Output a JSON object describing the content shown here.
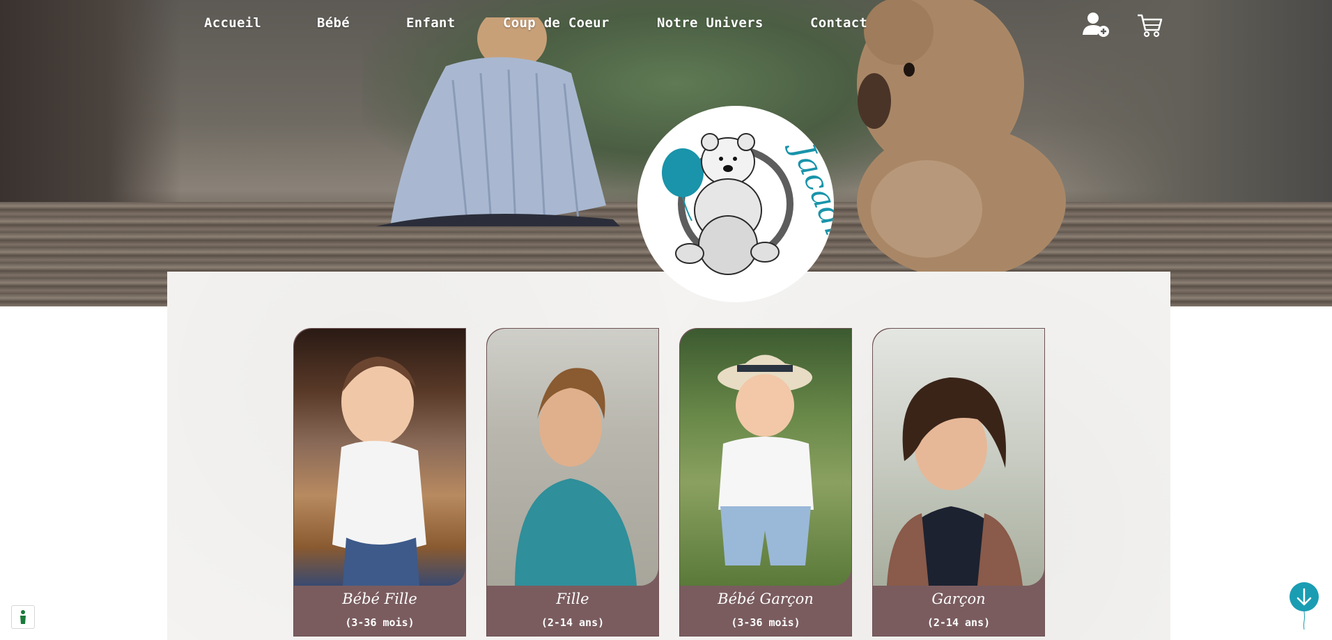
{
  "nav": {
    "items": [
      {
        "label": "Accueil"
      },
      {
        "label": "Bébé"
      },
      {
        "label": "Enfant"
      },
      {
        "label": "Coup de Coeur"
      },
      {
        "label": "Notre Univers"
      },
      {
        "label": "Contact"
      }
    ],
    "account_icon": "user-plus-icon",
    "cart_icon": "shopping-cart-icon"
  },
  "logo": {
    "text": "Jacadi",
    "icon": "teddy-bear-with-balloon-logo"
  },
  "categories": [
    {
      "title": "Bébé Fille",
      "subtitle": "(3-36 mois)",
      "image": "toddler-girl-autumn-leaves-photo"
    },
    {
      "title": "Fille",
      "subtitle": "(2-14 ans)",
      "image": "girl-blue-sweater-photo"
    },
    {
      "title": "Bébé Garçon",
      "subtitle": "(3-36 mois)",
      "image": "toddler-boy-hat-suspenders-photo"
    },
    {
      "title": "Garçon",
      "subtitle": "(2-14 ans)",
      "image": "boy-curly-hair-photo"
    }
  ],
  "widgets": {
    "scroll_down_icon": "arrow-down-balloon-icon",
    "accessibility_icon": "accessibility-icon"
  },
  "colors": {
    "card_background": "#7a5c5f",
    "accent": "#1a9db2",
    "nav_text": "#ffffff",
    "content_background": "#f4f3f1"
  }
}
